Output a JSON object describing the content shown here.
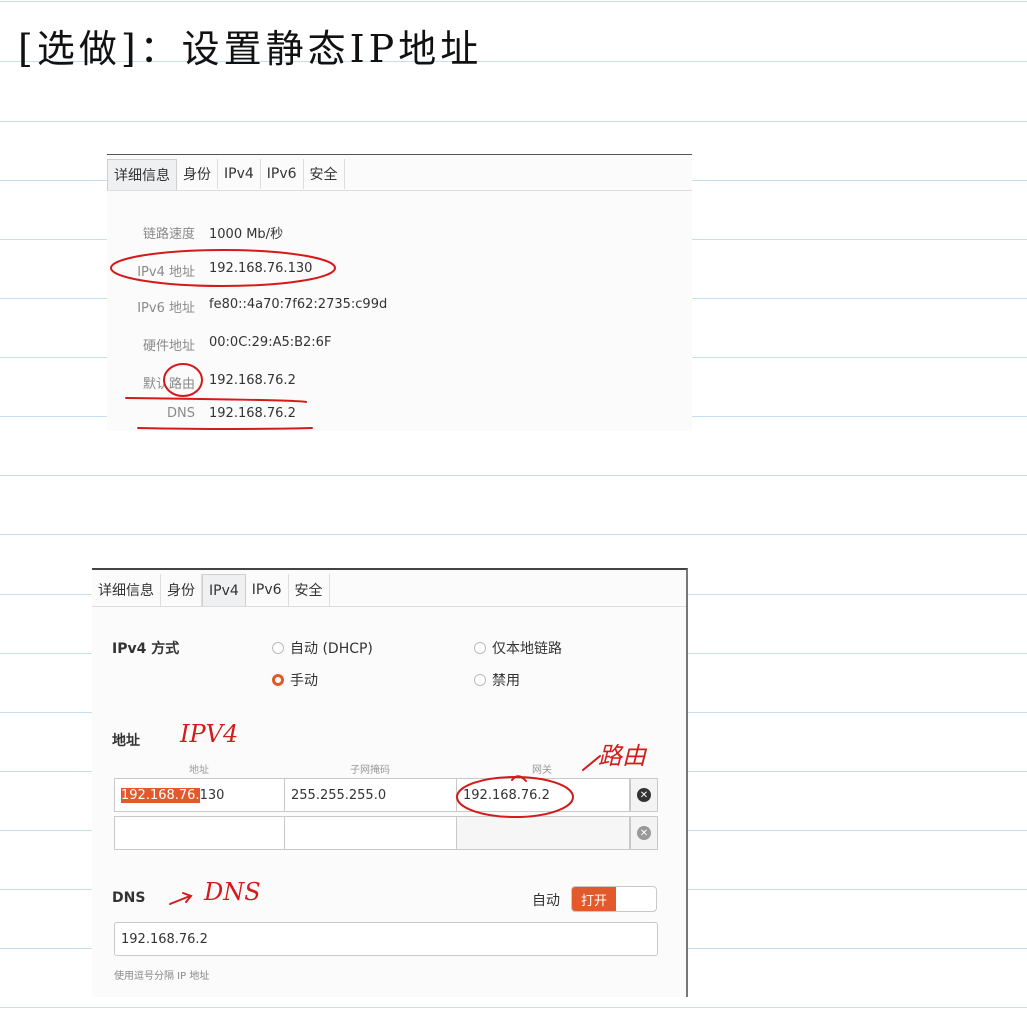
{
  "note": {
    "heading": "[选做]：设置静态IP地址",
    "annot_ipv4": "IPV4",
    "annot_route": "路由",
    "annot_dns": "DNS"
  },
  "details_panel": {
    "tabs": [
      "详细信息",
      "身份",
      "IPv4",
      "IPv6",
      "安全"
    ],
    "active_tab": 0,
    "rows": [
      {
        "label": "链路速度",
        "value": "1000 Mb/秒"
      },
      {
        "label": "IPv4 地址",
        "value": "192.168.76.130"
      },
      {
        "label": "IPv6 地址",
        "value": "fe80::4a70:7f62:2735:c99d"
      },
      {
        "label": "硬件地址",
        "value": "00:0C:29:A5:B2:6F"
      },
      {
        "label": "默认路由",
        "value": "192.168.76.2"
      },
      {
        "label": "DNS",
        "value": "192.168.76.2"
      }
    ]
  },
  "ipv4_panel": {
    "tabs": [
      "详细信息",
      "身份",
      "IPv4",
      "IPv6",
      "安全"
    ],
    "active_tab": 2,
    "method_label": "IPv4 方式",
    "methods": [
      "自动 (DHCP)",
      "仅本地链路",
      "手动",
      "禁用"
    ],
    "selected_method": "手动",
    "address_section": "地址",
    "columns": [
      "地址",
      "子网掩码",
      "网关"
    ],
    "address_highlight": "192.168.76.",
    "address_rest": "130",
    "netmask": "255.255.255.0",
    "gateway": "192.168.76.2",
    "dns_section": "DNS",
    "auto_label": "自动",
    "toggle_on": "打开",
    "dns_value": "192.168.76.2",
    "dns_hint": "使用逗号分隔 IP 地址",
    "accent": "#e25a2b"
  }
}
